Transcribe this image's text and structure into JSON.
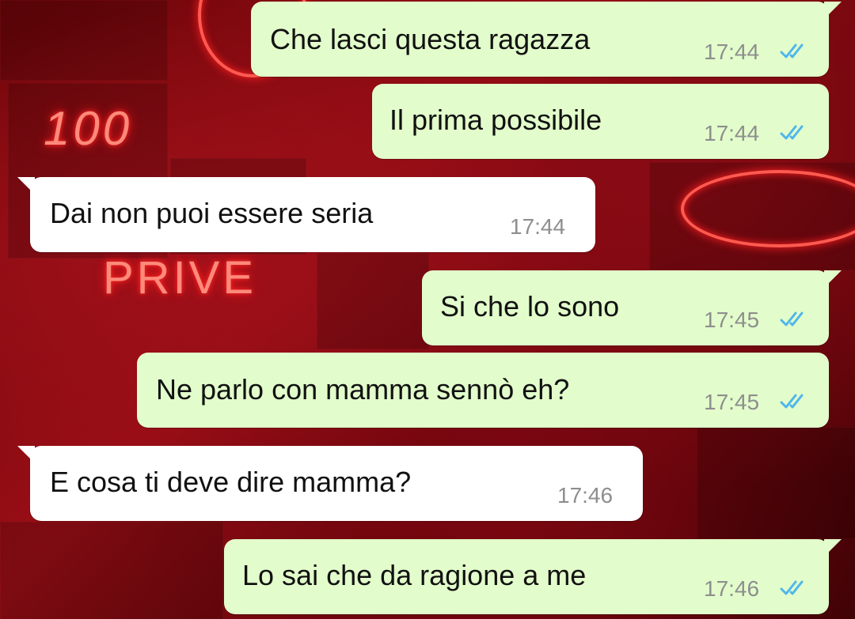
{
  "theme": {
    "outgoing_bubble": "#e2fdcb",
    "incoming_bubble": "#ffffff",
    "read_ticks": "#4fb6ec",
    "timestamp": "#8e8e8e",
    "wallpaper_accent": "#d0121e"
  },
  "wallpaper": {
    "neon_text_1": "100",
    "neon_text_2": "PRIVE"
  },
  "messages": [
    {
      "direction": "outgoing",
      "text": "Che lasci questa ragazza",
      "time": "17:44",
      "status": "read-double-check-icon"
    },
    {
      "direction": "outgoing",
      "text": "Il prima possibile",
      "time": "17:44",
      "status": "read-double-check-icon"
    },
    {
      "direction": "incoming",
      "text": "Dai non puoi essere seria",
      "time": "17:44"
    },
    {
      "direction": "outgoing",
      "text": "Si che lo sono",
      "time": "17:45",
      "status": "read-double-check-icon"
    },
    {
      "direction": "outgoing",
      "text": "Ne parlo con mamma sennò eh?",
      "time": "17:45",
      "status": "read-double-check-icon"
    },
    {
      "direction": "incoming",
      "text": "E cosa ti deve dire mamma?",
      "time": "17:46"
    },
    {
      "direction": "outgoing",
      "text": "Lo sai che da ragione a me",
      "time": "17:46",
      "status": "read-double-check-icon"
    }
  ]
}
